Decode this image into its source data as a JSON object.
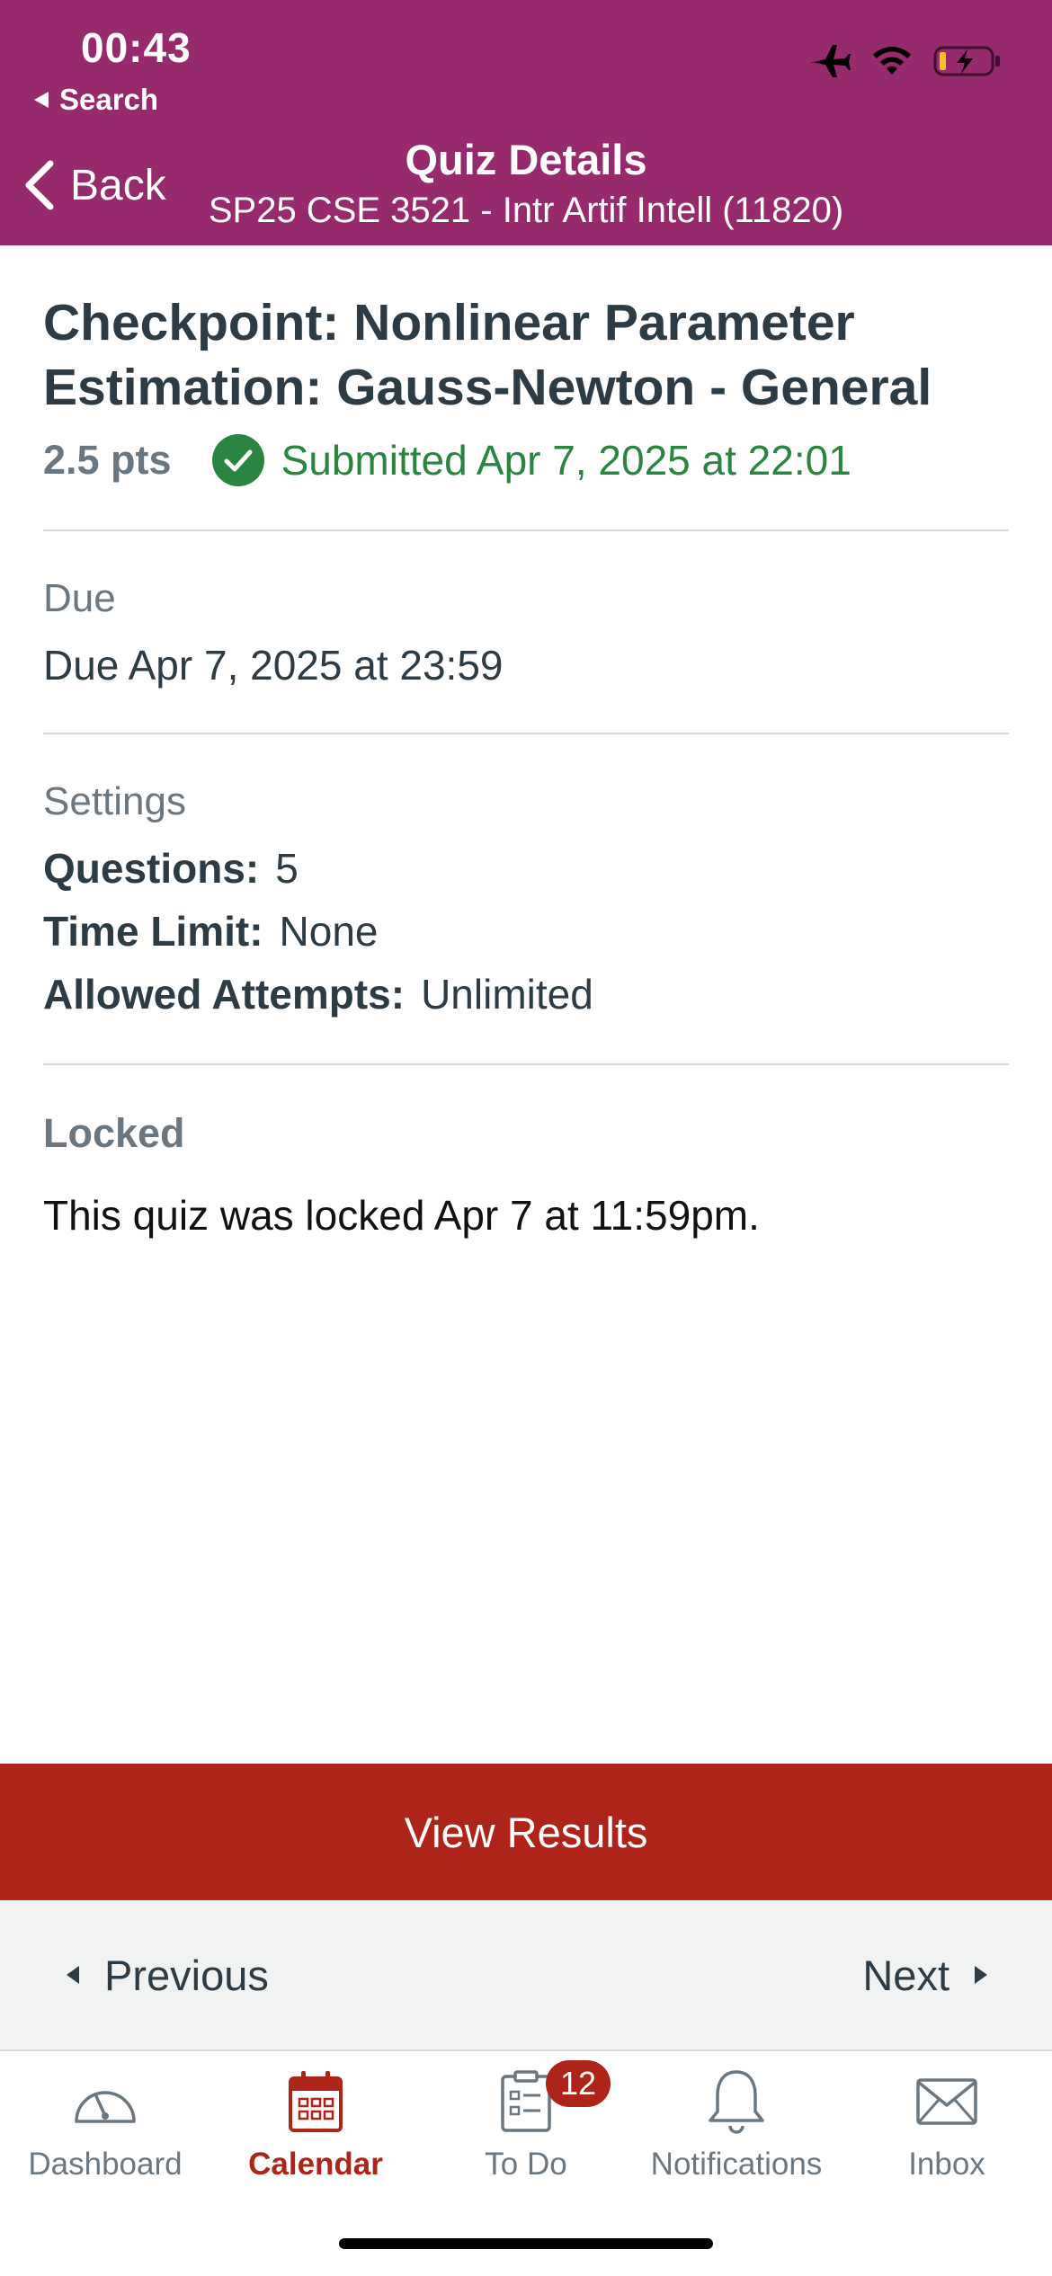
{
  "status_bar": {
    "time": "00:43",
    "back_app": "Search"
  },
  "nav": {
    "back_label": "Back",
    "title": "Quiz Details",
    "subtitle": "SP25 CSE 3521 - Intr Artif Intell (11820)"
  },
  "quiz": {
    "title": "Checkpoint: Nonlinear Parameter Estimation: Gauss-Newton - General",
    "points": "2.5 pts",
    "submitted": "Submitted Apr 7, 2025 at 22:01"
  },
  "due": {
    "label": "Due",
    "value": "Due Apr 7, 2025 at 23:59"
  },
  "settings": {
    "label": "Settings",
    "rows": [
      {
        "key": "Questions:",
        "value": "5"
      },
      {
        "key": "Time Limit:",
        "value": "None"
      },
      {
        "key": "Allowed Attempts:",
        "value": "Unlimited"
      }
    ]
  },
  "locked": {
    "label": "Locked",
    "text": "This quiz was locked Apr 7 at 11:59pm."
  },
  "actions": {
    "view_results": "View Results"
  },
  "pager": {
    "previous": "Previous",
    "next": "Next"
  },
  "tabs": [
    {
      "label": "Dashboard",
      "icon": "dashboard-icon"
    },
    {
      "label": "Calendar",
      "icon": "calendar-icon",
      "active": true
    },
    {
      "label": "To Do",
      "icon": "todo-icon",
      "badge": "12"
    },
    {
      "label": "Notifications",
      "icon": "bell-icon"
    },
    {
      "label": "Inbox",
      "icon": "inbox-icon"
    }
  ],
  "colors": {
    "header": "#972a6c",
    "primary": "#ae2418",
    "success": "#2a8540",
    "muted": "#6b7780",
    "text": "#2d3b45"
  }
}
